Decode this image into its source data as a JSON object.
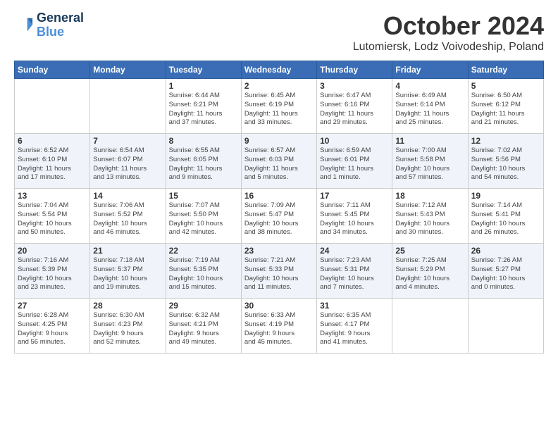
{
  "logo": {
    "line1": "General",
    "line2": "Blue"
  },
  "title": "October 2024",
  "location": "Lutomiersk, Lodz Voivodeship, Poland",
  "weekdays": [
    "Sunday",
    "Monday",
    "Tuesday",
    "Wednesday",
    "Thursday",
    "Friday",
    "Saturday"
  ],
  "weeks": [
    [
      {
        "day": "",
        "info": ""
      },
      {
        "day": "",
        "info": ""
      },
      {
        "day": "1",
        "info": "Sunrise: 6:44 AM\nSunset: 6:21 PM\nDaylight: 11 hours\nand 37 minutes."
      },
      {
        "day": "2",
        "info": "Sunrise: 6:45 AM\nSunset: 6:19 PM\nDaylight: 11 hours\nand 33 minutes."
      },
      {
        "day": "3",
        "info": "Sunrise: 6:47 AM\nSunset: 6:16 PM\nDaylight: 11 hours\nand 29 minutes."
      },
      {
        "day": "4",
        "info": "Sunrise: 6:49 AM\nSunset: 6:14 PM\nDaylight: 11 hours\nand 25 minutes."
      },
      {
        "day": "5",
        "info": "Sunrise: 6:50 AM\nSunset: 6:12 PM\nDaylight: 11 hours\nand 21 minutes."
      }
    ],
    [
      {
        "day": "6",
        "info": "Sunrise: 6:52 AM\nSunset: 6:10 PM\nDaylight: 11 hours\nand 17 minutes."
      },
      {
        "day": "7",
        "info": "Sunrise: 6:54 AM\nSunset: 6:07 PM\nDaylight: 11 hours\nand 13 minutes."
      },
      {
        "day": "8",
        "info": "Sunrise: 6:55 AM\nSunset: 6:05 PM\nDaylight: 11 hours\nand 9 minutes."
      },
      {
        "day": "9",
        "info": "Sunrise: 6:57 AM\nSunset: 6:03 PM\nDaylight: 11 hours\nand 5 minutes."
      },
      {
        "day": "10",
        "info": "Sunrise: 6:59 AM\nSunset: 6:01 PM\nDaylight: 11 hours\nand 1 minute."
      },
      {
        "day": "11",
        "info": "Sunrise: 7:00 AM\nSunset: 5:58 PM\nDaylight: 10 hours\nand 57 minutes."
      },
      {
        "day": "12",
        "info": "Sunrise: 7:02 AM\nSunset: 5:56 PM\nDaylight: 10 hours\nand 54 minutes."
      }
    ],
    [
      {
        "day": "13",
        "info": "Sunrise: 7:04 AM\nSunset: 5:54 PM\nDaylight: 10 hours\nand 50 minutes."
      },
      {
        "day": "14",
        "info": "Sunrise: 7:06 AM\nSunset: 5:52 PM\nDaylight: 10 hours\nand 46 minutes."
      },
      {
        "day": "15",
        "info": "Sunrise: 7:07 AM\nSunset: 5:50 PM\nDaylight: 10 hours\nand 42 minutes."
      },
      {
        "day": "16",
        "info": "Sunrise: 7:09 AM\nSunset: 5:47 PM\nDaylight: 10 hours\nand 38 minutes."
      },
      {
        "day": "17",
        "info": "Sunrise: 7:11 AM\nSunset: 5:45 PM\nDaylight: 10 hours\nand 34 minutes."
      },
      {
        "day": "18",
        "info": "Sunrise: 7:12 AM\nSunset: 5:43 PM\nDaylight: 10 hours\nand 30 minutes."
      },
      {
        "day": "19",
        "info": "Sunrise: 7:14 AM\nSunset: 5:41 PM\nDaylight: 10 hours\nand 26 minutes."
      }
    ],
    [
      {
        "day": "20",
        "info": "Sunrise: 7:16 AM\nSunset: 5:39 PM\nDaylight: 10 hours\nand 23 minutes."
      },
      {
        "day": "21",
        "info": "Sunrise: 7:18 AM\nSunset: 5:37 PM\nDaylight: 10 hours\nand 19 minutes."
      },
      {
        "day": "22",
        "info": "Sunrise: 7:19 AM\nSunset: 5:35 PM\nDaylight: 10 hours\nand 15 minutes."
      },
      {
        "day": "23",
        "info": "Sunrise: 7:21 AM\nSunset: 5:33 PM\nDaylight: 10 hours\nand 11 minutes."
      },
      {
        "day": "24",
        "info": "Sunrise: 7:23 AM\nSunset: 5:31 PM\nDaylight: 10 hours\nand 7 minutes."
      },
      {
        "day": "25",
        "info": "Sunrise: 7:25 AM\nSunset: 5:29 PM\nDaylight: 10 hours\nand 4 minutes."
      },
      {
        "day": "26",
        "info": "Sunrise: 7:26 AM\nSunset: 5:27 PM\nDaylight: 10 hours\nand 0 minutes."
      }
    ],
    [
      {
        "day": "27",
        "info": "Sunrise: 6:28 AM\nSunset: 4:25 PM\nDaylight: 9 hours\nand 56 minutes."
      },
      {
        "day": "28",
        "info": "Sunrise: 6:30 AM\nSunset: 4:23 PM\nDaylight: 9 hours\nand 52 minutes."
      },
      {
        "day": "29",
        "info": "Sunrise: 6:32 AM\nSunset: 4:21 PM\nDaylight: 9 hours\nand 49 minutes."
      },
      {
        "day": "30",
        "info": "Sunrise: 6:33 AM\nSunset: 4:19 PM\nDaylight: 9 hours\nand 45 minutes."
      },
      {
        "day": "31",
        "info": "Sunrise: 6:35 AM\nSunset: 4:17 PM\nDaylight: 9 hours\nand 41 minutes."
      },
      {
        "day": "",
        "info": ""
      },
      {
        "day": "",
        "info": ""
      }
    ]
  ]
}
